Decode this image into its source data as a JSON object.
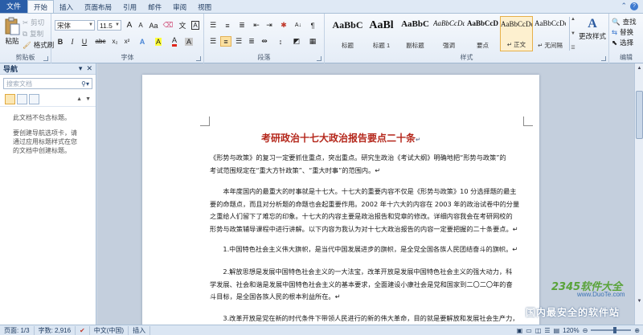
{
  "tabs": {
    "file": "文件",
    "items": [
      "开始",
      "插入",
      "页面布局",
      "引用",
      "邮件",
      "审阅",
      "视图"
    ],
    "active_index": 0
  },
  "ribbon": {
    "clipboard": {
      "label": "剪贴板",
      "paste": "粘贴",
      "cut": "剪切",
      "copy": "复制",
      "format_painter": "格式刷"
    },
    "font": {
      "label": "字体",
      "font_name": "宋体",
      "font_size": "11.5",
      "grow": "A",
      "shrink": "A",
      "bold": "B",
      "italic": "I",
      "underline": "U",
      "strike": "abc",
      "subscript": "x₂",
      "superscript": "x²",
      "highlight": "A",
      "color": "A"
    },
    "paragraph": {
      "label": "段落"
    },
    "styles": {
      "label": "样式",
      "items": [
        {
          "sample": "AaBbC",
          "name": "标题"
        },
        {
          "sample": "AaBl",
          "name": "标题 1"
        },
        {
          "sample": "AaBbC",
          "name": "副标题"
        },
        {
          "sample": "AaBbCcDd",
          "name": "强调"
        },
        {
          "sample": "AaBbCcD",
          "name": "要点"
        },
        {
          "sample": "AaBbCcDc",
          "name": "↵ 正文"
        },
        {
          "sample": "AaBbCcDc",
          "name": "↵ 无间隔"
        }
      ],
      "selected_index": 5,
      "change_styles": "更改样式"
    },
    "editing": {
      "label": "编辑",
      "find": "查找",
      "replace": "替换",
      "select": "选择"
    }
  },
  "nav": {
    "title": "导航",
    "search_placeholder": "搜索文档",
    "text1": "此文档不包含标题。",
    "text2": "要创建导航选项卡，请通过应用标题样式在您的文档中创建标题。"
  },
  "document": {
    "title": "考研政治十七大政治报告要点二十条",
    "paragraphs": [
      [
        "《形势与政策》的复习一定要抓住重点，突出重点。研究生政治《考试大纲》明确地把“形势与政策”的",
        "考试范围规定在“重大方针政策”、“重大时事”的范围内。↵"
      ],
      [
        "　　本年度国内的最重大的时事就是十七大。十七大的重要内容不仅是《形势与政策》10 分选择题的最主",
        "要的命题点，而且对分析题的命题也会起重要作用。2002 年十六大的内容在 2003 年的政治试卷中的分量",
        "之重给人们留下了难忘的印象。十七大的内容主要是政治报告和党章的修改。详细内容我会在考研网校的",
        "形势与政策辅导课程中进行讲解。以下内容为我认为对十七大政治报告的内容一定要把握的二十条要点。↵"
      ],
      [
        "　　1.中国特色社会主义伟大旗帜，是当代中国发展进步的旗帜，是全党全国各族人民团结奋斗的旗帜。↵"
      ],
      [
        "　　2.解放思想是发展中国特色社会主义的一大法宝，改革开放是发展中国特色社会主义的强大动力，科",
        "学发展、社会和谐是发展中国特色社会主义的基本要求，全面建设小康社会是党和国家到二〇二〇年的奋",
        "斗目标，是全国各族人民的根本利益所在。↵"
      ],
      [
        "　　3.改革开放是党在新的时代条件下带领人民进行的新的伟大革命，目的就是要解放和发展社会生产力，"
      ]
    ]
  },
  "status": {
    "page": "页面: 1/3",
    "words": "字数: 2,916",
    "language": "中文(中国)",
    "mode": "插入",
    "zoom": "120%"
  },
  "watermark": {
    "logo": "2345软件大全",
    "url": "www.DuoTe.com",
    "slogan": "国内最安全的软件站"
  }
}
